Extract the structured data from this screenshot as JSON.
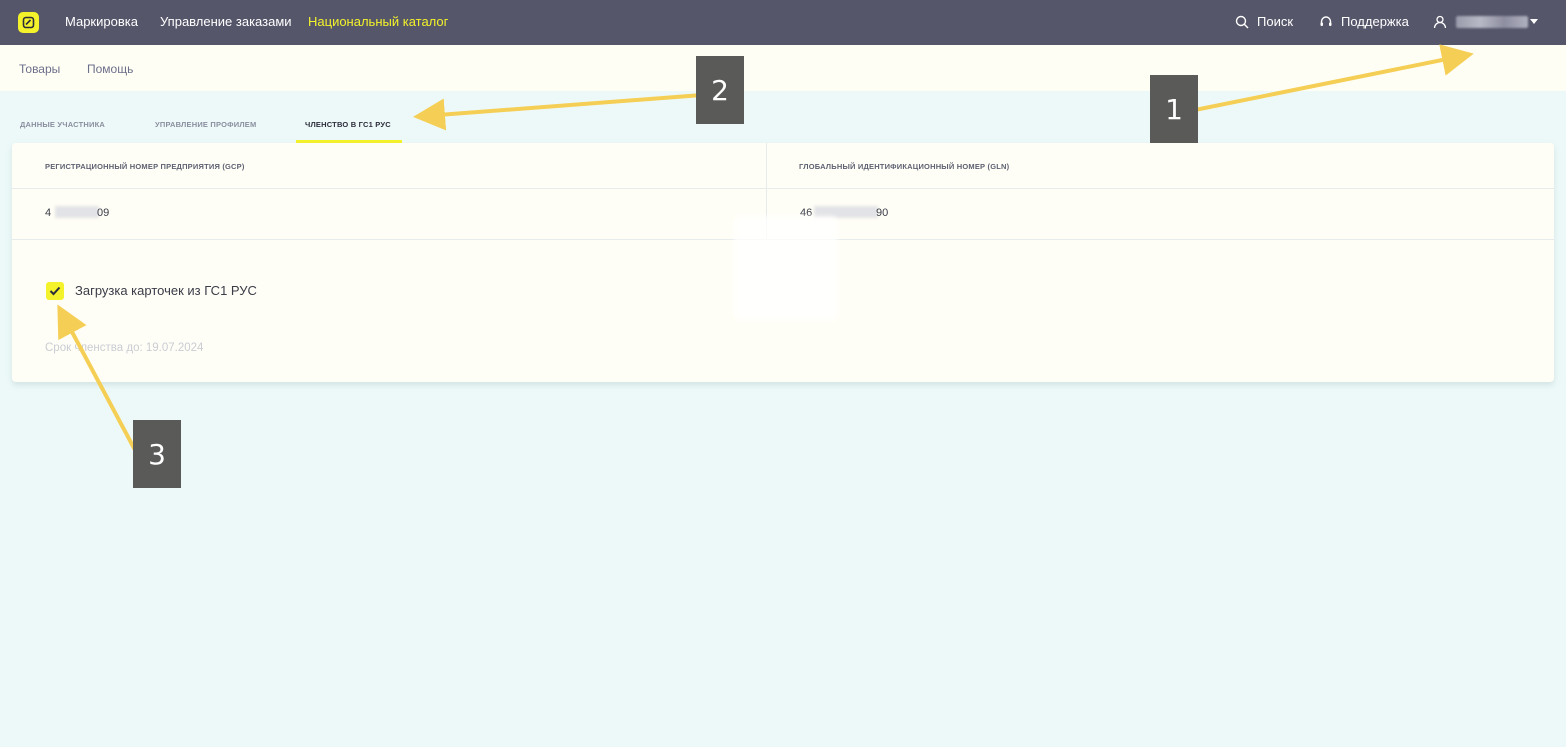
{
  "topbar": {
    "nav": [
      "Маркировка",
      "Управление заказами",
      "Национальный каталог"
    ],
    "active_nav": "Национальный каталог",
    "search_label": "Поиск",
    "support_label": "Поддержка",
    "icons": [
      "logo-icon",
      "search-icon",
      "headset-icon",
      "user-icon",
      "caret-down-icon"
    ]
  },
  "subnav": [
    "Товары",
    "Помощь"
  ],
  "tabs": [
    "Данные участника",
    "Управление профилем",
    "Членство в ГС1 РУС"
  ],
  "active_tab": "Членство в ГС1 РУС",
  "card": {
    "gcp_label": "Регистрационный номер предприятия (GCP)",
    "gln_label": "Глобальный идентификационный номер (GLN)",
    "gcp_value_start": "4",
    "gcp_value_end": "09",
    "gln_value_start": "46",
    "gln_value_end": "90",
    "checkbox_label": "Загрузка карточек из ГС1 РУС",
    "checkbox_checked": true,
    "expiry_text": "Срок членства до: 19.07.2024"
  },
  "annotations": [
    "1",
    "2",
    "3"
  ],
  "colors": {
    "topbar": "#55566a",
    "accent": "#f4f22a",
    "page_bg": "#edf9f9",
    "marker": "#5a5a58",
    "arrow": "#f5cf55"
  }
}
